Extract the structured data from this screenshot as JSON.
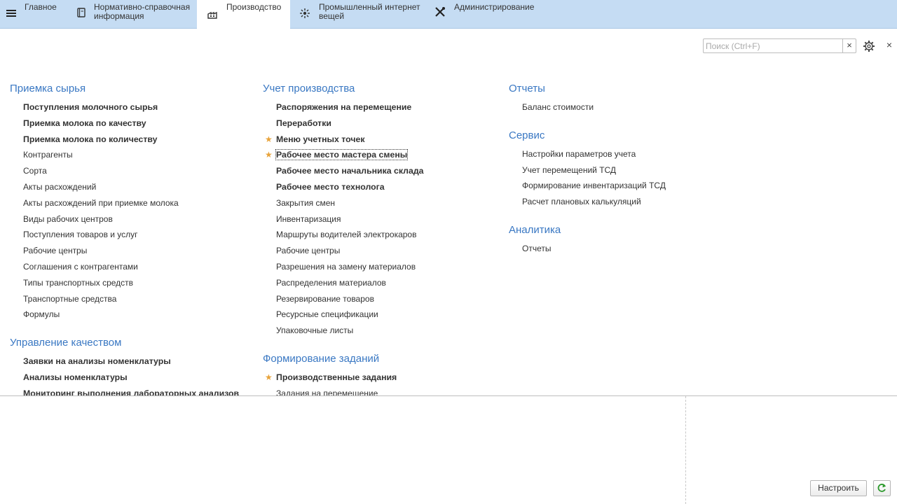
{
  "sections": [
    {
      "label": "Главное",
      "icon": "hamburger-icon",
      "active": false
    },
    {
      "label": "Нормативно-справочная\nинформация",
      "icon": "book-icon",
      "active": false
    },
    {
      "label": "Производство",
      "icon": "factory-icon",
      "active": true
    },
    {
      "label": "Промышленный интернет\nвещей",
      "icon": "iot-icon",
      "active": false
    },
    {
      "label": "Администрирование",
      "icon": "tools-icon",
      "active": false
    }
  ],
  "search": {
    "placeholder": "Поиск (Ctrl+F)",
    "value": "",
    "clear": "×"
  },
  "close": "×",
  "columns": [
    {
      "groups": [
        {
          "title": "Приемка сырья",
          "items": [
            {
              "label": "Поступления молочного сырья",
              "bold": true,
              "star": false
            },
            {
              "label": "Приемка молока по качеству",
              "bold": true,
              "star": false
            },
            {
              "label": "Приемка молока по количеству",
              "bold": true,
              "star": false
            },
            {
              "label": "Контрагенты",
              "bold": false,
              "star": false
            },
            {
              "label": "Сорта",
              "bold": false,
              "star": false
            },
            {
              "label": "Акты расхождений",
              "bold": false,
              "star": false
            },
            {
              "label": "Акты расхождений при приемке молока",
              "bold": false,
              "star": false
            },
            {
              "label": "Виды рабочих центров",
              "bold": false,
              "star": false
            },
            {
              "label": "Поступления товаров и услуг",
              "bold": false,
              "star": false
            },
            {
              "label": "Рабочие центры",
              "bold": false,
              "star": false
            },
            {
              "label": "Соглашения с контрагентами",
              "bold": false,
              "star": false
            },
            {
              "label": "Типы транспортных средств",
              "bold": false,
              "star": false
            },
            {
              "label": "Транспортные средства",
              "bold": false,
              "star": false
            },
            {
              "label": "Формулы",
              "bold": false,
              "star": false
            }
          ]
        },
        {
          "title": "Управление качеством",
          "items": [
            {
              "label": "Заявки на анализы номенклатуры",
              "bold": true,
              "star": false
            },
            {
              "label": "Анализы номенклатуры",
              "bold": true,
              "star": false
            },
            {
              "label": "Мониторинг выполнения лабораторных анализов",
              "bold": true,
              "star": false
            }
          ]
        }
      ]
    },
    {
      "groups": [
        {
          "title": "Учет производства",
          "items": [
            {
              "label": "Распоряжения на перемещение",
              "bold": true,
              "star": false
            },
            {
              "label": "Переработки",
              "bold": true,
              "star": false
            },
            {
              "label": "Меню учетных точек",
              "bold": true,
              "star": true
            },
            {
              "label": "Рабочее место мастера смены",
              "bold": true,
              "star": true,
              "focused": true
            },
            {
              "label": "Рабочее место начальника склада",
              "bold": true,
              "star": false
            },
            {
              "label": "Рабочее место технолога",
              "bold": true,
              "star": false
            },
            {
              "label": "Закрытия смен",
              "bold": false,
              "star": false
            },
            {
              "label": "Инвентаризация",
              "bold": false,
              "star": false
            },
            {
              "label": "Маршруты водителей электрокаров",
              "bold": false,
              "star": false
            },
            {
              "label": "Рабочие центры",
              "bold": false,
              "star": false
            },
            {
              "label": "Разрешения на замену материалов",
              "bold": false,
              "star": false
            },
            {
              "label": "Распределения материалов",
              "bold": false,
              "star": false
            },
            {
              "label": "Резервирование товаров",
              "bold": false,
              "star": false
            },
            {
              "label": "Ресурсные спецификации",
              "bold": false,
              "star": false
            },
            {
              "label": "Упаковочные листы",
              "bold": false,
              "star": false
            }
          ]
        },
        {
          "title": "Формирование заданий",
          "items": [
            {
              "label": "Производственные задания",
              "bold": true,
              "star": true
            },
            {
              "label": "Задания на перемещение",
              "bold": false,
              "star": false
            }
          ]
        }
      ]
    },
    {
      "groups": [
        {
          "title": "Отчеты",
          "items": [
            {
              "label": "Баланс стоимости",
              "bold": false,
              "star": false
            }
          ]
        },
        {
          "title": "Сервис",
          "items": [
            {
              "label": "Настройки параметров учета",
              "bold": false,
              "star": false
            },
            {
              "label": "Учет перемещений ТСД",
              "bold": false,
              "star": false
            },
            {
              "label": "Формирование инвентаризаций ТСД",
              "bold": false,
              "star": false
            },
            {
              "label": "Расчет плановых калькуляций",
              "bold": false,
              "star": false
            }
          ]
        },
        {
          "title": "Аналитика",
          "items": [
            {
              "label": "Отчеты",
              "bold": false,
              "star": false
            }
          ]
        }
      ]
    }
  ],
  "footer": {
    "setup_label": "Настроить"
  },
  "colors": {
    "accent_bar": "#c5dcf3",
    "group_title": "#3a78c3",
    "star": "#e8a33a",
    "refresh": "#2e9a2e"
  }
}
